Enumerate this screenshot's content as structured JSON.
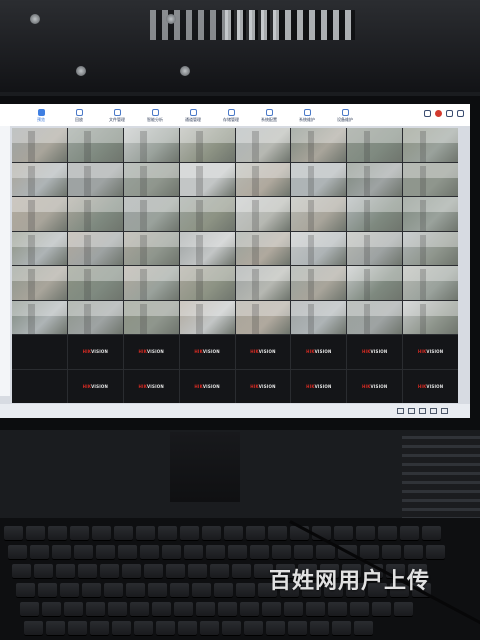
{
  "watermark": "百姓网用户上传",
  "nvr": {
    "tabs": [
      {
        "label": "预览",
        "active": true
      },
      {
        "label": "回放",
        "active": false
      },
      {
        "label": "文件管理",
        "active": false
      },
      {
        "label": "智能分析",
        "active": false
      },
      {
        "label": "通道管理",
        "active": false
      },
      {
        "label": "存储管理",
        "active": false
      },
      {
        "label": "系统配置",
        "active": false
      },
      {
        "label": "系统维护",
        "active": false
      },
      {
        "label": "设备维护",
        "active": false
      }
    ],
    "empty_channel_logo_brand": "HIK",
    "empty_channel_logo_rest": "VISION",
    "accent_color": "#d72b23"
  }
}
